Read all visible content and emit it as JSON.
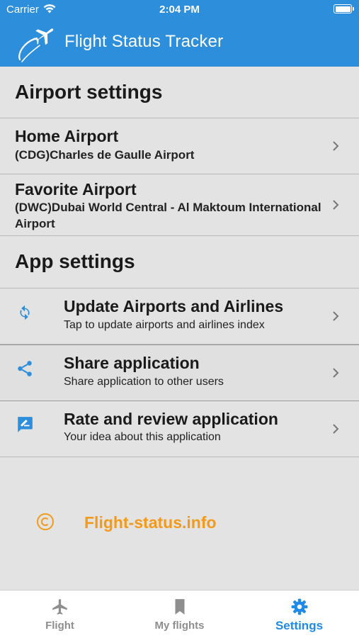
{
  "status_bar": {
    "carrier": "Carrier",
    "time": "2:04 PM"
  },
  "header": {
    "title": "Flight Status Tracker",
    "logo_icon": "airplane-swoosh-logo"
  },
  "airport_settings": {
    "heading": "Airport settings",
    "home": {
      "label": "Home Airport",
      "value": "(CDG)Charles de Gaulle Airport"
    },
    "favorite": {
      "label": "Favorite Airport",
      "value": "(DWC)Dubai World Central - Al Maktoum International Airport"
    }
  },
  "app_settings": {
    "heading": "App settings",
    "items": [
      {
        "icon": "refresh-icon",
        "label": "Update Airports and Airlines",
        "sub": "Tap to update airports and airlines index"
      },
      {
        "icon": "share-icon",
        "label": "Share application",
        "sub": "Share application to other users"
      },
      {
        "icon": "rate-review-icon",
        "label": "Rate and review application",
        "sub": "Your idea about this application"
      }
    ]
  },
  "footer": {
    "site": "Flight-status.info",
    "icon": "copyright-icon"
  },
  "tabs": [
    {
      "label": "Flight",
      "icon": "airplane-icon",
      "active": false
    },
    {
      "label": "My flights",
      "icon": "bookmark-icon",
      "active": false
    },
    {
      "label": "Settings",
      "icon": "gear-icon",
      "active": true
    }
  ],
  "colors": {
    "primary": "#2d8fdc",
    "accent": "#1f8ae8",
    "brand_orange": "#f39a1a",
    "background": "#e3e3e3"
  }
}
